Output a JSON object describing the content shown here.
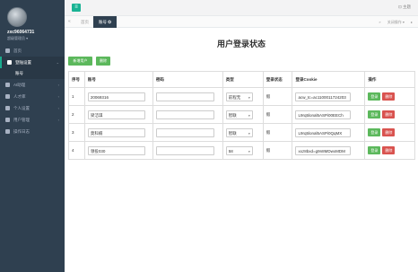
{
  "sidebar": {
    "username": "zxc96064731",
    "subtitle": "超级管理员 ▾",
    "items": [
      {
        "label": "首页",
        "icon": "home-icon"
      },
      {
        "label": "登陆设置",
        "icon": "gear-icon",
        "active": true
      },
      {
        "label": "账号",
        "sub": true
      },
      {
        "label": "AI助理",
        "icon": "robot-icon"
      },
      {
        "label": "人才库",
        "icon": "users-icon"
      },
      {
        "label": "个人设置",
        "icon": "user-icon"
      },
      {
        "label": "用户管理",
        "icon": "user-group-icon"
      },
      {
        "label": "操作日志",
        "icon": "log-icon"
      }
    ]
  },
  "topbar": {
    "menu_icon": "≡",
    "logout": "⊡ 主题"
  },
  "tabs": {
    "home": "首页",
    "current": "账号 ✪",
    "close_ops": "关闭操作 ▾",
    "nav_left": "«",
    "nav_right": "»",
    "refresh": "▸"
  },
  "page": {
    "title": "用户登录状态",
    "add_button": "新增用户",
    "delete_button": "删除"
  },
  "table": {
    "headers": [
      "序号",
      "账号",
      "密码",
      "类型",
      "登录状态",
      "登录Cookie",
      "操作"
    ],
    "rows": [
      {
        "index": "1",
        "account": "20069316",
        "password": "",
        "type": "前程无",
        "status": "假",
        "cookie": "acw_tc=ac1100011724203"
      },
      {
        "index": "2",
        "account": "梁洁琪",
        "password": "",
        "type": "智联",
        "status": "假",
        "cookie": "L9rq5lonal5ASPi00EECh"
      },
      {
        "index": "3",
        "account": "莫科楠",
        "password": "",
        "type": "智联",
        "status": "假",
        "cookie": "L9rq5lonal5ASPi0QqMX"
      },
      {
        "index": "4",
        "account": "领投030",
        "password": "",
        "type": "58",
        "status": "假",
        "cookie": "xxz8bxd=g9n8MDwxMDM"
      }
    ],
    "login_label": "登录",
    "delete_label": "删除"
  }
}
